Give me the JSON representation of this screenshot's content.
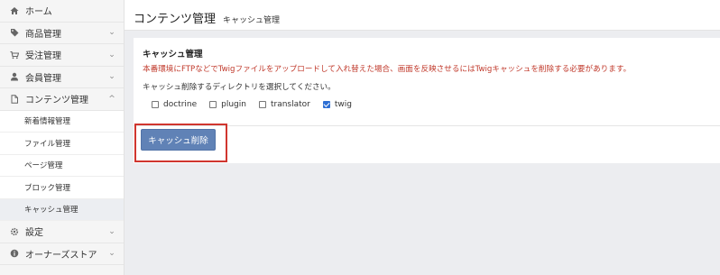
{
  "sidebar": {
    "items": [
      {
        "label": "ホーム",
        "icon": "home-icon",
        "chevron": ""
      },
      {
        "label": "商品管理",
        "icon": "tag-icon",
        "chevron": "⌄"
      },
      {
        "label": "受注管理",
        "icon": "cart-icon",
        "chevron": "⌄"
      },
      {
        "label": "会員管理",
        "icon": "user-icon",
        "chevron": "⌄"
      },
      {
        "label": "コンテンツ管理",
        "icon": "file-icon",
        "chevron": "^"
      }
    ],
    "sub_items": [
      {
        "label": "新着情報管理"
      },
      {
        "label": "ファイル管理"
      },
      {
        "label": "ページ管理"
      },
      {
        "label": "ブロック管理"
      },
      {
        "label": "キャッシュ管理"
      }
    ],
    "bottom_items": [
      {
        "label": "設定",
        "icon": "gear-icon",
        "chevron": "⌄"
      },
      {
        "label": "オーナーズストア",
        "icon": "info-icon",
        "chevron": "⌄"
      }
    ]
  },
  "header": {
    "title": "コンテンツ管理",
    "breadcrumb": "キャッシュ管理"
  },
  "card": {
    "title": "キャッシュ管理",
    "warning": "本番環境にFTPなどでTwigファイルをアップロードして入れ替えた場合、画面を反映させるにはTwigキャッシュを削除する必要があります。",
    "description": "キャッシュ削除するディレクトリを選択してください。",
    "options": [
      {
        "label": "doctrine",
        "checked": false
      },
      {
        "label": "plugin",
        "checked": false
      },
      {
        "label": "translator",
        "checked": false
      },
      {
        "label": "twig",
        "checked": true
      }
    ],
    "button_label": "キャッシュ削除"
  }
}
